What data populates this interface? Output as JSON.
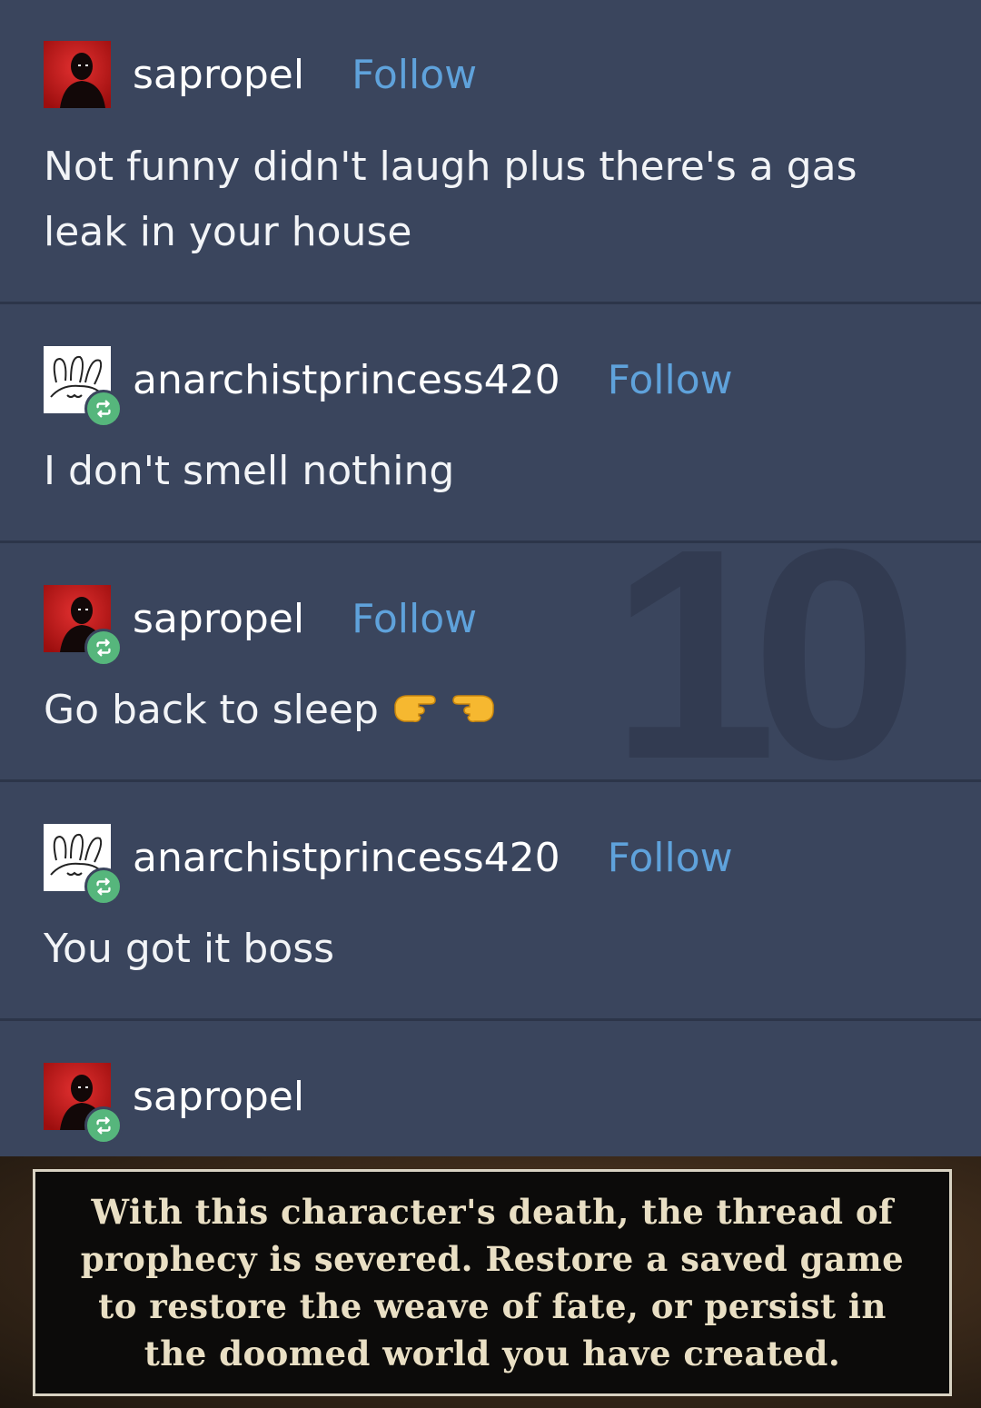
{
  "background_color": "#3a455d",
  "accent_follow": "#5fa2db",
  "reblog_badge_color": "#56b67c",
  "watermark": "10",
  "posts": [
    {
      "username": "sapropel",
      "follow_label": "Follow",
      "avatar_icon": "red-silhouette-avatar",
      "reblog_badge": false,
      "text": "Not funny didn't laugh plus there's a gas leak in your house"
    },
    {
      "username": "anarchistprincess420",
      "follow_label": "Follow",
      "avatar_icon": "bunny-sketch-avatar",
      "reblog_badge": true,
      "text": "I don't smell nothing"
    },
    {
      "username": "sapropel",
      "follow_label": "Follow",
      "avatar_icon": "red-silhouette-avatar",
      "reblog_badge": true,
      "text": "Go back to sleep",
      "emoji": "pointing-fingers-emoji"
    },
    {
      "username": "anarchistprincess420",
      "follow_label": "Follow",
      "avatar_icon": "bunny-sketch-avatar",
      "reblog_badge": true,
      "text": "You got it boss"
    },
    {
      "username": "sapropel",
      "avatar_icon": "red-silhouette-avatar",
      "reblog_badge": true
    }
  ],
  "game_message": "With this character's death, the thread of prophecy is severed. Restore a saved game to restore the weave of fate, or persist in the doomed world you have created."
}
